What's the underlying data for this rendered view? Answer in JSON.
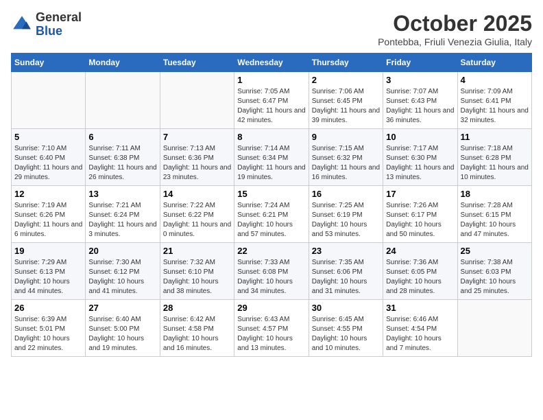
{
  "header": {
    "logo_general": "General",
    "logo_blue": "Blue",
    "month_title": "October 2025",
    "location": "Pontebba, Friuli Venezia Giulia, Italy"
  },
  "weekdays": [
    "Sunday",
    "Monday",
    "Tuesday",
    "Wednesday",
    "Thursday",
    "Friday",
    "Saturday"
  ],
  "weeks": [
    [
      {
        "day": "",
        "info": ""
      },
      {
        "day": "",
        "info": ""
      },
      {
        "day": "",
        "info": ""
      },
      {
        "day": "1",
        "info": "Sunrise: 7:05 AM\nSunset: 6:47 PM\nDaylight: 11 hours and 42 minutes."
      },
      {
        "day": "2",
        "info": "Sunrise: 7:06 AM\nSunset: 6:45 PM\nDaylight: 11 hours and 39 minutes."
      },
      {
        "day": "3",
        "info": "Sunrise: 7:07 AM\nSunset: 6:43 PM\nDaylight: 11 hours and 36 minutes."
      },
      {
        "day": "4",
        "info": "Sunrise: 7:09 AM\nSunset: 6:41 PM\nDaylight: 11 hours and 32 minutes."
      }
    ],
    [
      {
        "day": "5",
        "info": "Sunrise: 7:10 AM\nSunset: 6:40 PM\nDaylight: 11 hours and 29 minutes."
      },
      {
        "day": "6",
        "info": "Sunrise: 7:11 AM\nSunset: 6:38 PM\nDaylight: 11 hours and 26 minutes."
      },
      {
        "day": "7",
        "info": "Sunrise: 7:13 AM\nSunset: 6:36 PM\nDaylight: 11 hours and 23 minutes."
      },
      {
        "day": "8",
        "info": "Sunrise: 7:14 AM\nSunset: 6:34 PM\nDaylight: 11 hours and 19 minutes."
      },
      {
        "day": "9",
        "info": "Sunrise: 7:15 AM\nSunset: 6:32 PM\nDaylight: 11 hours and 16 minutes."
      },
      {
        "day": "10",
        "info": "Sunrise: 7:17 AM\nSunset: 6:30 PM\nDaylight: 11 hours and 13 minutes."
      },
      {
        "day": "11",
        "info": "Sunrise: 7:18 AM\nSunset: 6:28 PM\nDaylight: 11 hours and 10 minutes."
      }
    ],
    [
      {
        "day": "12",
        "info": "Sunrise: 7:19 AM\nSunset: 6:26 PM\nDaylight: 11 hours and 6 minutes."
      },
      {
        "day": "13",
        "info": "Sunrise: 7:21 AM\nSunset: 6:24 PM\nDaylight: 11 hours and 3 minutes."
      },
      {
        "day": "14",
        "info": "Sunrise: 7:22 AM\nSunset: 6:22 PM\nDaylight: 11 hours and 0 minutes."
      },
      {
        "day": "15",
        "info": "Sunrise: 7:24 AM\nSunset: 6:21 PM\nDaylight: 10 hours and 57 minutes."
      },
      {
        "day": "16",
        "info": "Sunrise: 7:25 AM\nSunset: 6:19 PM\nDaylight: 10 hours and 53 minutes."
      },
      {
        "day": "17",
        "info": "Sunrise: 7:26 AM\nSunset: 6:17 PM\nDaylight: 10 hours and 50 minutes."
      },
      {
        "day": "18",
        "info": "Sunrise: 7:28 AM\nSunset: 6:15 PM\nDaylight: 10 hours and 47 minutes."
      }
    ],
    [
      {
        "day": "19",
        "info": "Sunrise: 7:29 AM\nSunset: 6:13 PM\nDaylight: 10 hours and 44 minutes."
      },
      {
        "day": "20",
        "info": "Sunrise: 7:30 AM\nSunset: 6:12 PM\nDaylight: 10 hours and 41 minutes."
      },
      {
        "day": "21",
        "info": "Sunrise: 7:32 AM\nSunset: 6:10 PM\nDaylight: 10 hours and 38 minutes."
      },
      {
        "day": "22",
        "info": "Sunrise: 7:33 AM\nSunset: 6:08 PM\nDaylight: 10 hours and 34 minutes."
      },
      {
        "day": "23",
        "info": "Sunrise: 7:35 AM\nSunset: 6:06 PM\nDaylight: 10 hours and 31 minutes."
      },
      {
        "day": "24",
        "info": "Sunrise: 7:36 AM\nSunset: 6:05 PM\nDaylight: 10 hours and 28 minutes."
      },
      {
        "day": "25",
        "info": "Sunrise: 7:38 AM\nSunset: 6:03 PM\nDaylight: 10 hours and 25 minutes."
      }
    ],
    [
      {
        "day": "26",
        "info": "Sunrise: 6:39 AM\nSunset: 5:01 PM\nDaylight: 10 hours and 22 minutes."
      },
      {
        "day": "27",
        "info": "Sunrise: 6:40 AM\nSunset: 5:00 PM\nDaylight: 10 hours and 19 minutes."
      },
      {
        "day": "28",
        "info": "Sunrise: 6:42 AM\nSunset: 4:58 PM\nDaylight: 10 hours and 16 minutes."
      },
      {
        "day": "29",
        "info": "Sunrise: 6:43 AM\nSunset: 4:57 PM\nDaylight: 10 hours and 13 minutes."
      },
      {
        "day": "30",
        "info": "Sunrise: 6:45 AM\nSunset: 4:55 PM\nDaylight: 10 hours and 10 minutes."
      },
      {
        "day": "31",
        "info": "Sunrise: 6:46 AM\nSunset: 4:54 PM\nDaylight: 10 hours and 7 minutes."
      },
      {
        "day": "",
        "info": ""
      }
    ]
  ]
}
